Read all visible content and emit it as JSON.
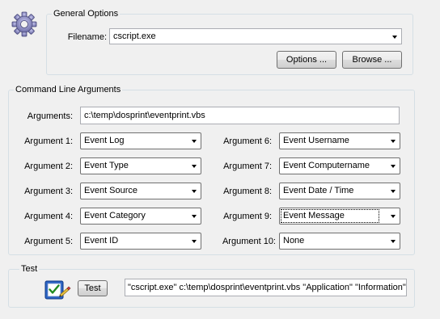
{
  "general": {
    "title": "General Options",
    "filename_label": "Filename:",
    "filename_value": "cscript.exe",
    "options_button": "Options ...",
    "browse_button": "Browse ..."
  },
  "cmd": {
    "title": "Command Line Arguments",
    "arguments_label": "Arguments:",
    "arguments_value": "c:\\temp\\dosprint\\eventprint.vbs",
    "args": [
      {
        "label": "Argument 1:",
        "value": "Event Log"
      },
      {
        "label": "Argument 2:",
        "value": "Event Type"
      },
      {
        "label": "Argument 3:",
        "value": "Event Source"
      },
      {
        "label": "Argument 4:",
        "value": "Event Category"
      },
      {
        "label": "Argument 5:",
        "value": "Event ID"
      },
      {
        "label": "Argument 6:",
        "value": "Event Username"
      },
      {
        "label": "Argument 7:",
        "value": "Event Computername"
      },
      {
        "label": "Argument 8:",
        "value": "Event Date / Time"
      },
      {
        "label": "Argument 9:",
        "value": "Event Message"
      },
      {
        "label": "Argument 10:",
        "value": "None"
      }
    ]
  },
  "test": {
    "title": "Test",
    "button": "Test",
    "output": "\"cscript.exe\" c:\\temp\\dosprint\\eventprint.vbs \"Application\" \"Information\""
  }
}
